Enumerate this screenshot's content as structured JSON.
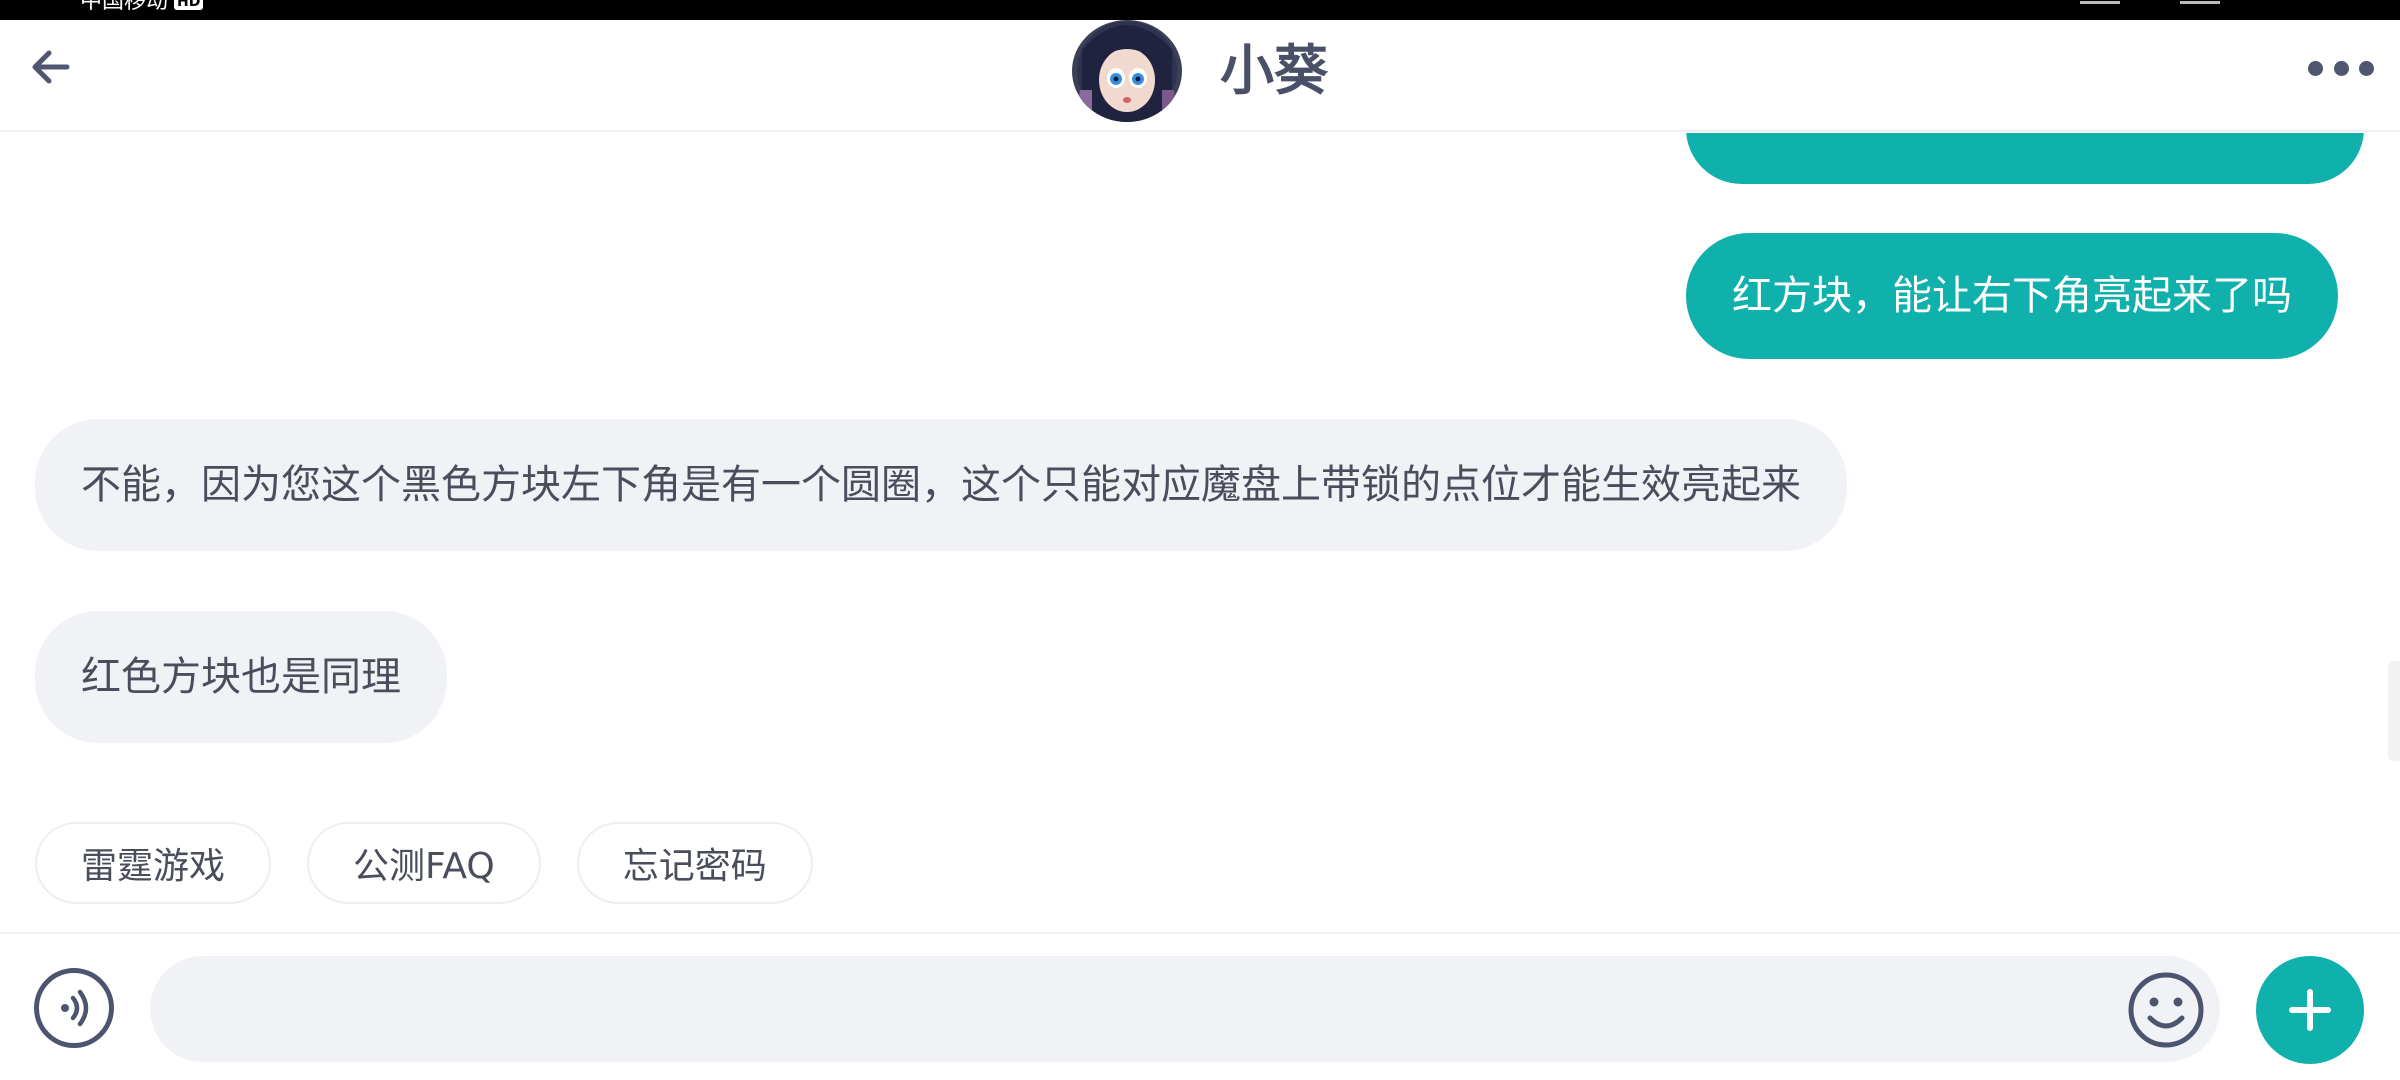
{
  "status_bar": {
    "carrier": "中国移动",
    "hd_badge": "HD"
  },
  "header": {
    "title": "小葵",
    "back_icon": "arrow-left-icon",
    "more_icon": "more-horizontal-icon",
    "avatar": "character-avatar"
  },
  "messages": [
    {
      "from": "user",
      "text": ""
    },
    {
      "from": "user",
      "text": "红方块，能让右下角亮起来了吗"
    },
    {
      "from": "bot",
      "text": "不能，因为您这个黑色方块左下角是有一个圆圈，这个只能对应魔盘上带锁的点位才能生效亮起来"
    },
    {
      "from": "bot",
      "text": "红色方块也是同理"
    }
  ],
  "quick_replies": [
    "雷霆游戏",
    "公测FAQ",
    "忘记密码"
  ],
  "input": {
    "value": "",
    "placeholder": "",
    "voice_icon": "voice-icon",
    "emoji_icon": "smile-icon",
    "plus_icon": "plus-icon"
  },
  "colors": {
    "accent": "#10b0ad",
    "incoming_bubble": "#f0f2f6",
    "text_dark": "#4a4e5c",
    "icon": "#4f5670"
  }
}
